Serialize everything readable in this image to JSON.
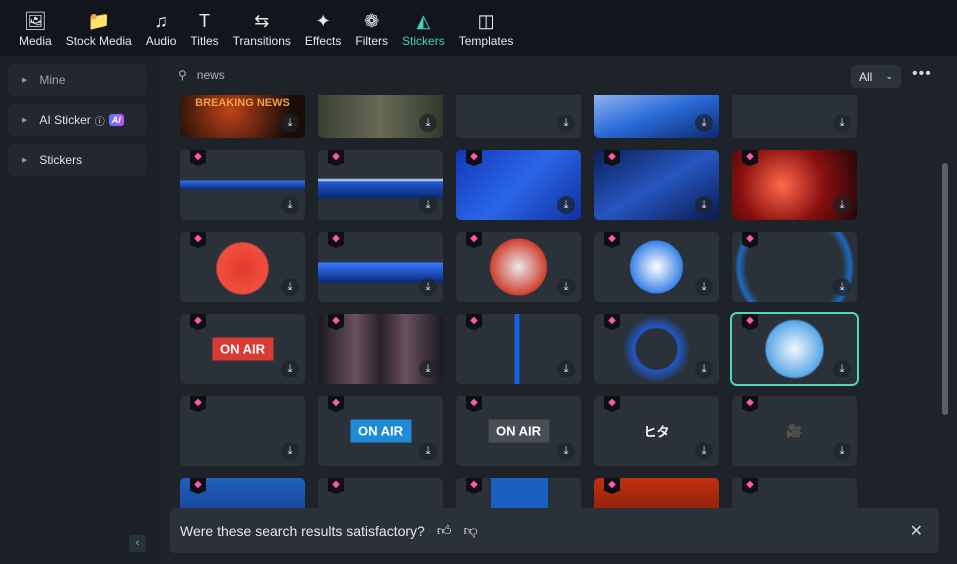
{
  "tabs": [
    {
      "label": "Media",
      "icon": "🖼"
    },
    {
      "label": "Stock Media",
      "icon": "📁"
    },
    {
      "label": "Audio",
      "icon": "♫"
    },
    {
      "label": "Titles",
      "icon": "T"
    },
    {
      "label": "Transitions",
      "icon": "⇆"
    },
    {
      "label": "Effects",
      "icon": "✦"
    },
    {
      "label": "Filters",
      "icon": "❁"
    },
    {
      "label": "Stickers",
      "icon": "◭",
      "active": true
    },
    {
      "label": "Templates",
      "icon": "◫"
    }
  ],
  "sidebar": {
    "items": [
      {
        "label": "Mine"
      },
      {
        "label": "AI Sticker",
        "badge": "AI"
      },
      {
        "label": "Stickers"
      }
    ]
  },
  "search": {
    "value": "news"
  },
  "filter": {
    "selected": "All"
  },
  "cards": [
    {
      "bg": "radial-gradient(circle at 40% 60%,#c0421a,#1a0d08 70%)",
      "text": "BREAKING NEWS",
      "premium": false
    },
    {
      "bg": "linear-gradient(90deg,#3a4030,#6a6a58,#2f3a28)",
      "premium": false
    },
    {
      "bg": "linear-gradient(#2a3139 0,#2a3139 0%,#0f3fae 0,#0a2a70 20px,#2a3139 20px)",
      "premium": false
    },
    {
      "bg": "linear-gradient(160deg,#cfe3ff,#2a6ad8 60%,#0c2a70)",
      "premium": false
    },
    {
      "bg": "linear-gradient(#2a3139 0,#2a3139 0%,#f5a020 0,#ffd070 12px,#2a3139 12px)",
      "premium": false
    },
    {
      "bg": "linear-gradient(#2a3139 30px,#2f6ee0 31px,#0a2a80 39px,#2a3139 40px)",
      "premium": true
    },
    {
      "bg": "linear-gradient(#2a3139 28px,#d8e6ff 30px,#1f5ad0 32px,#0a2a70 48px,#2a3139 49px)",
      "premium": true
    },
    {
      "bg": "linear-gradient(135deg,#1437b8,#2a66e8 50%,#1030a0)",
      "premium": true
    },
    {
      "bg": "linear-gradient(150deg,#0c1f5a,#2656c0 50%,#0a1a50)",
      "premium": true
    },
    {
      "bg": "radial-gradient(circle at 40% 50%,#ff6a4a,#8a1010 50%,#200608)",
      "premium": true
    },
    {
      "bg": "radial-gradient(circle at 50% 52%,#e43a2a 0,#f05040 25px,#2a3139 27px)",
      "premium": true
    },
    {
      "bg": "linear-gradient(#2a3139 30px,#3a7aff 31px,#0a2a80 50px,#2a3139 51px)",
      "premium": true
    },
    {
      "bg": "radial-gradient(circle at 50% 50%,#e8e8e8 0,#d04030 28px,#2a3139 29px)",
      "premium": true
    },
    {
      "bg": "radial-gradient(circle at 50% 50%,#ffffff 0,#3a82e8 26px,#2a3139 27px)",
      "premium": true
    },
    {
      "bg": "radial-gradient(circle at 50% 50%,#2a3139 48px,#1b6ac0 56px,#2a3139 60px)",
      "premium": true
    },
    {
      "bg": "#2a3139",
      "text": "ON AIR",
      "textbg": "#d83a34",
      "premium": true
    },
    {
      "bg": "linear-gradient(90deg,#1a1820,#6a5060 30%,#2a2028 50%,#6a5060 70%,#1a1820)",
      "premium": true
    },
    {
      "bg": "linear-gradient(90deg,#2a3139 58px,#1a60e0 59px,#1a60e0 63px,#2a3139 64px)",
      "premium": true
    },
    {
      "bg": "radial-gradient(circle at 50% 50%,#2a3139 0,#2a3139 20px,#2058c8 22px,#2a3139 34px)",
      "premium": true
    },
    {
      "bg": "radial-gradient(circle at 50% 50%,#f4f8fc 0,#58a8e8 28px,#2a3139 30px)",
      "premium": true,
      "selected": true
    },
    {
      "bg": "linear-gradient(#2a3139 10px,transparent 10px),conic-gradient(from 160deg at 50% 100%,transparent 0,#e8201a 1deg,#e8201a 40deg,transparent 41deg) #2a3139",
      "premium": true
    },
    {
      "bg": "#2a3139",
      "text": "ON AIR",
      "textbg": "#1f8ad8",
      "premium": true
    },
    {
      "bg": "#2a3139",
      "text": "ON AIR",
      "textbg": "#4a4f55",
      "premium": true
    },
    {
      "bg": "#2a3139",
      "text": "ヒタ",
      "textbg": "transparent",
      "premium": true
    },
    {
      "bg": "#2a3139",
      "text": "🎥",
      "textbg": "transparent",
      "premium": true
    },
    {
      "bg": "linear-gradient(#2060c0,#0a2a70)",
      "premium": true
    },
    {
      "bg": "radial-gradient(circle at 50% 90%,#2a80c0,#2a3139 30px)",
      "premium": true
    },
    {
      "bg": "linear-gradient(90deg,#2a3139 35px,#1a60c0 35px,#1a60c0 92px,#2a3139 92px)",
      "premium": true
    },
    {
      "bg": "linear-gradient(#c03010,#601008)",
      "premium": true
    },
    {
      "bg": "radial-gradient(circle at 50% 90%,#3a424c,#2a3139 30px)",
      "premium": true
    }
  ],
  "feedback": {
    "question": "Were these search results satisfactory?"
  }
}
